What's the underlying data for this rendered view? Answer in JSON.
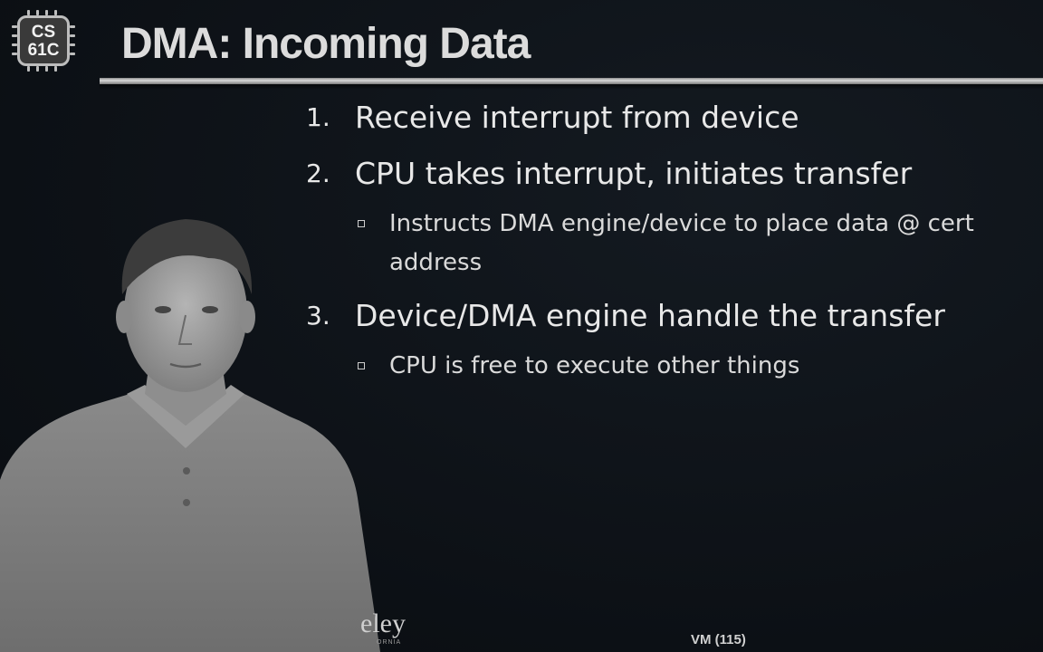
{
  "logo": {
    "line1": "CS",
    "line2": "61C"
  },
  "title": "DMA: Incoming Data",
  "items": [
    {
      "number": "1.",
      "text": "Receive interrupt from device",
      "subs": []
    },
    {
      "number": "2.",
      "text": "CPU takes interrupt, initiates transfer",
      "subs": [
        {
          "line1": "Instructs DMA engine/device to place data @ cert",
          "line2": "address"
        }
      ]
    },
    {
      "number": "3.",
      "text": "Device/DMA engine handle the transfer",
      "subs": [
        {
          "line1": "CPU is free to execute other things",
          "line2": ""
        }
      ]
    }
  ],
  "footer": {
    "logo_text": "eley",
    "logo_sub": "ORNIA",
    "page": "VM (115)"
  },
  "colors": {
    "background": "#0e1217",
    "rule": "#d8d8d8",
    "text": "#e8e8e8"
  }
}
